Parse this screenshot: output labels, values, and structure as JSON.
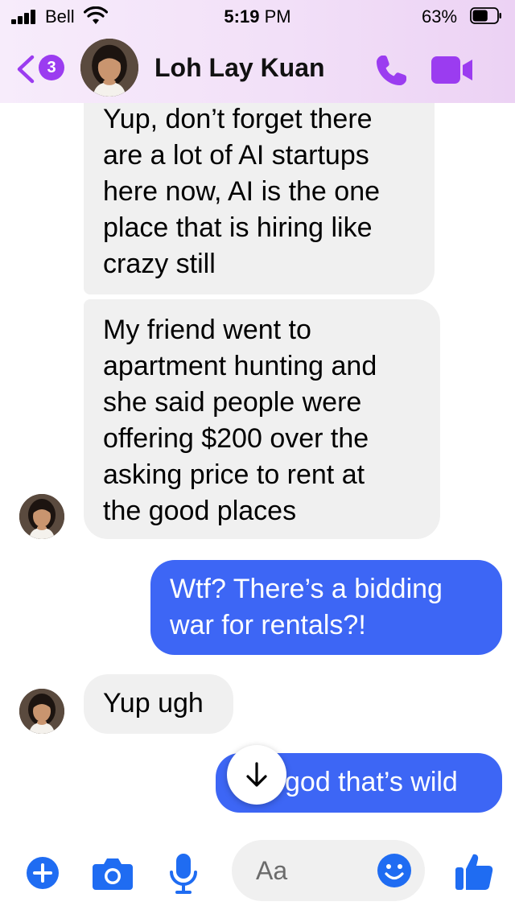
{
  "status_bar": {
    "carrier": "Bell",
    "time": "5:19",
    "time_suffix": " PM",
    "battery": "63%",
    "battery_level": 0.63
  },
  "header": {
    "unread_count": "3",
    "contact_name": "Loh Lay Kuan",
    "accent_color": "#9b3cf0"
  },
  "messages": [
    {
      "direction": "incoming",
      "lines": [
        "Yup, don’t forget there",
        "are a lot of AI startups",
        "here now, AI is the one",
        "place that is hiring like",
        "crazy still"
      ]
    },
    {
      "direction": "incoming",
      "lines": [
        "My friend went to",
        "apartment hunting and",
        "she said people were",
        "offering $200 over the",
        "asking price to rent at",
        "the good places"
      ]
    },
    {
      "direction": "outgoing",
      "lines": [
        "Wtf? There’s a bidding",
        "war for rentals?!"
      ]
    },
    {
      "direction": "incoming",
      "lines": [
        "Yup ugh"
      ]
    },
    {
      "direction": "outgoing",
      "lines": [
        "god that’s wild"
      ]
    }
  ],
  "composer": {
    "placeholder": "Aa",
    "icons": [
      "plus-icon",
      "camera-icon",
      "microphone-icon",
      "emoji-icon",
      "thumbs-up-icon"
    ]
  },
  "colors": {
    "outgoing_bubble": "#3d66f5",
    "incoming_bubble": "#f0f0f0",
    "icon_blue": "#1f6cf2"
  }
}
